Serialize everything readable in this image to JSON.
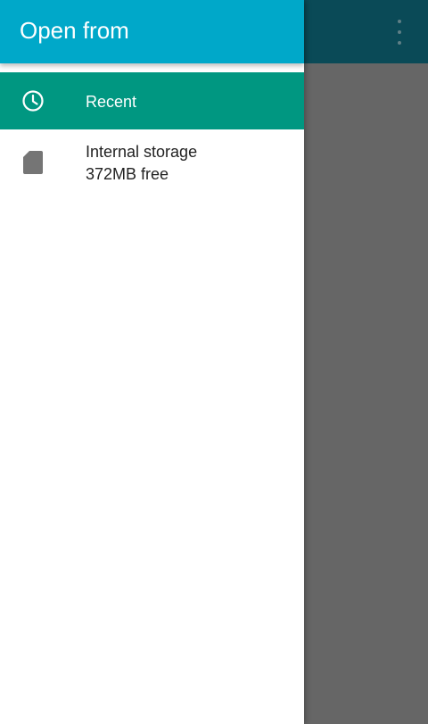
{
  "drawer": {
    "title": "Open from",
    "roots": [
      {
        "label": "Recent",
        "icon": "clock-icon",
        "selected": true
      },
      {
        "label": "Internal storage",
        "summary": "372MB free",
        "icon": "sd-card-icon",
        "selected": false
      }
    ]
  },
  "background": {
    "overflow_icon": "more-vert-icon"
  },
  "colors": {
    "drawer_header": "#00a8c9",
    "selected_item": "#009781",
    "scrim": "#666666",
    "dimmed_appbar": "#0a4a57"
  }
}
